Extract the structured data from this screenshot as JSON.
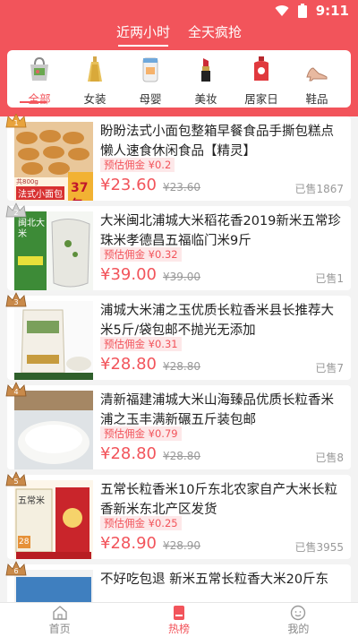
{
  "status": {
    "time": "9:11"
  },
  "top_tabs": [
    {
      "label": "近两小时",
      "active": true
    },
    {
      "label": "全天疯抢",
      "active": false
    }
  ],
  "categories": [
    {
      "label": "全部",
      "icon": "bag-icon",
      "active": true
    },
    {
      "label": "女装",
      "icon": "dress-icon",
      "active": false
    },
    {
      "label": "母婴",
      "icon": "milk-powder-icon",
      "active": false
    },
    {
      "label": "美妆",
      "icon": "lipstick-icon",
      "active": false
    },
    {
      "label": "居家日",
      "icon": "detergent-bottle-icon",
      "active": false
    },
    {
      "label": "鞋品",
      "icon": "high-heel-icon",
      "active": false
    }
  ],
  "products": [
    {
      "title": "盼盼法式小面包整箱早餐食品手撕包糕点懒人速食休闲食品【精灵】",
      "commission": "预估佣金 ¥0.2",
      "price": "¥23.60",
      "original_price": "¥23.60",
      "sold": "已售1867",
      "thumb_text_1": "共800g",
      "thumb_text_2": "法式小面包",
      "thumb_text_3": "37包",
      "rank": "1"
    },
    {
      "title": "大米闽北浦城大米稻花香2019新米五常珍珠米孝德昌五福临门米9斤",
      "commission": "预估佣金 ¥0.32",
      "price": "¥39.00",
      "original_price": "¥39.00",
      "sold": "已售1",
      "thumb_text_1": "闽北大米",
      "rank": "2"
    },
    {
      "title": "浦城大米浦之玉优质长粒香米县长推荐大米5斤/袋包邮不抛光无添加",
      "commission": "预估佣金 ¥0.31",
      "price": "¥28.80",
      "original_price": "¥28.80",
      "sold": "已售7",
      "rank": "3"
    },
    {
      "title": "清新福建浦城大米山海臻品优质长粒香米浦之玉丰满新碾五斤装包邮",
      "commission": "预估佣金 ¥0.79",
      "price": "¥28.80",
      "original_price": "¥28.80",
      "sold": "已售8",
      "rank": "4"
    },
    {
      "title": "五常长粒香米10斤东北农家自产大米长粒香新米东北产区发货",
      "commission": "预估佣金 ¥0.25",
      "price": "¥28.90",
      "original_price": "¥28.90",
      "sold": "已售3955",
      "thumb_text_1": "五常米",
      "thumb_text_2": "28",
      "rank": "5"
    },
    {
      "title": "不好吃包退 新米五常长粒香大米20斤东",
      "commission": "",
      "price": "",
      "original_price": "",
      "sold": "",
      "rank": "6"
    }
  ],
  "tabbar": [
    {
      "label": "首页",
      "icon": "home-icon",
      "active": false
    },
    {
      "label": "热榜",
      "icon": "hot-list-icon",
      "active": true
    },
    {
      "label": "我的",
      "icon": "profile-icon",
      "active": false
    }
  ],
  "colors": {
    "accent": "#f2545b",
    "background": "#f3f3f3"
  }
}
